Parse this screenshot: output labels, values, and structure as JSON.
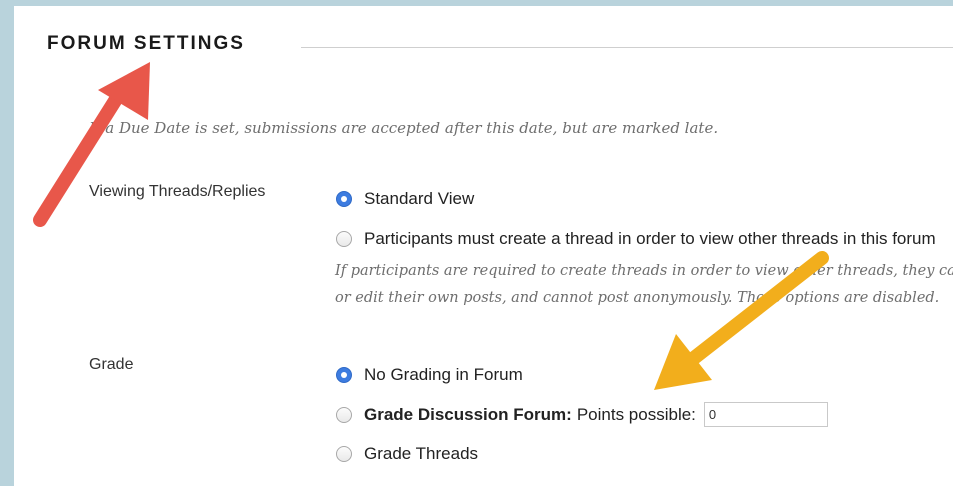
{
  "section": {
    "title": "FORUM SETTINGS",
    "instructions": "If a Due Date is set, submissions are accepted after this date, but are marked late."
  },
  "viewing": {
    "label": "Viewing Threads/Replies",
    "options": [
      {
        "label": "Standard View",
        "checked": true
      },
      {
        "label": "Participants must create a thread in order to view other threads in this forum",
        "checked": false
      }
    ],
    "help_line1": "If participants are required to create threads in order to view other threads, they cannot delete",
    "help_line2": "or edit their own posts, and cannot post anonymously. Those options are disabled."
  },
  "grade": {
    "label": "Grade",
    "options": [
      {
        "label": "No Grading in Forum",
        "checked": true
      },
      {
        "bold_label": "Grade Discussion Forum:",
        "label": "Points possible:",
        "checked": false
      },
      {
        "label": "Grade Threads",
        "checked": false
      }
    ],
    "points_value": "0"
  },
  "annotations": {
    "red_arrow_color": "#e8574a",
    "yellow_arrow_color": "#f2ae1c"
  }
}
